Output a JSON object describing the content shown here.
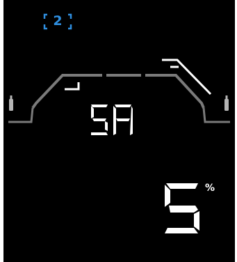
{
  "display": {
    "indicator": {
      "value": "2",
      "icon": "bracket-frame-icon",
      "color": "#2f8fe0"
    },
    "mode": {
      "text": "SA",
      "style": "seven-segment"
    },
    "level": {
      "value": "5",
      "unit": "%",
      "style": "seven-segment"
    },
    "icons": {
      "left": "cylinder-icon",
      "right": "cylinder-icon"
    },
    "colors": {
      "background": "#000000",
      "segments": "#ffffff",
      "track": "#7a7a7a",
      "accent": "#2f8fe0"
    }
  }
}
